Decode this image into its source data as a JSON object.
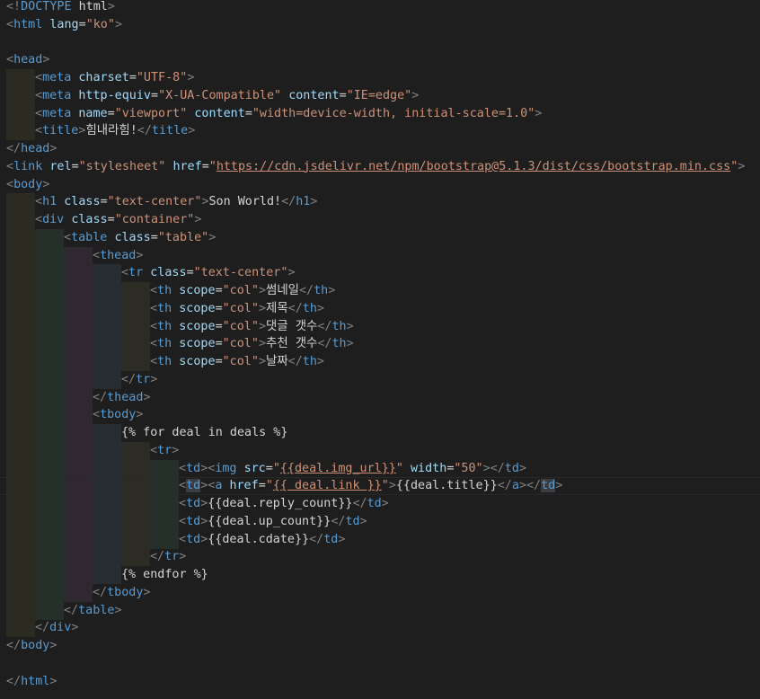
{
  "colors": {
    "background": "#1e1e1e",
    "bracket": "#808080",
    "tag": "#569cd6",
    "attribute": "#9cdcfe",
    "string": "#ce9178",
    "text": "#d4d4d4"
  },
  "lines": [
    {
      "indent": 0,
      "tokens": [
        [
          "bracket",
          "<!"
        ],
        [
          "tag",
          "DOCTYPE"
        ],
        [
          "text",
          " html"
        ],
        [
          "bracket",
          ">"
        ]
      ]
    },
    {
      "indent": 0,
      "tokens": [
        [
          "bracket",
          "<"
        ],
        [
          "tag",
          "html"
        ],
        [
          "text",
          " "
        ],
        [
          "attr",
          "lang"
        ],
        [
          "text",
          "="
        ],
        [
          "str",
          "\"ko\""
        ],
        [
          "bracket",
          ">"
        ]
      ]
    },
    {
      "indent": 0,
      "tokens": []
    },
    {
      "indent": 0,
      "tokens": [
        [
          "bracket",
          "<"
        ],
        [
          "tag",
          "head"
        ],
        [
          "bracket",
          ">"
        ]
      ]
    },
    {
      "indent": 1,
      "tokens": [
        [
          "bracket",
          "<"
        ],
        [
          "tag",
          "meta"
        ],
        [
          "text",
          " "
        ],
        [
          "attr",
          "charset"
        ],
        [
          "text",
          "="
        ],
        [
          "str",
          "\"UTF-8\""
        ],
        [
          "bracket",
          ">"
        ]
      ]
    },
    {
      "indent": 1,
      "tokens": [
        [
          "bracket",
          "<"
        ],
        [
          "tag",
          "meta"
        ],
        [
          "text",
          " "
        ],
        [
          "attr",
          "http-equiv"
        ],
        [
          "text",
          "="
        ],
        [
          "str",
          "\"X-UA-Compatible\""
        ],
        [
          "text",
          " "
        ],
        [
          "attr",
          "content"
        ],
        [
          "text",
          "="
        ],
        [
          "str",
          "\"IE=edge\""
        ],
        [
          "bracket",
          ">"
        ]
      ]
    },
    {
      "indent": 1,
      "tokens": [
        [
          "bracket",
          "<"
        ],
        [
          "tag",
          "meta"
        ],
        [
          "text",
          " "
        ],
        [
          "attr",
          "name"
        ],
        [
          "text",
          "="
        ],
        [
          "str",
          "\"viewport\""
        ],
        [
          "text",
          " "
        ],
        [
          "attr",
          "content"
        ],
        [
          "text",
          "="
        ],
        [
          "str",
          "\"width=device-width, initial-scale=1.0\""
        ],
        [
          "bracket",
          ">"
        ]
      ]
    },
    {
      "indent": 1,
      "tokens": [
        [
          "bracket",
          "<"
        ],
        [
          "tag",
          "title"
        ],
        [
          "bracket",
          ">"
        ],
        [
          "text",
          "힘내라힘!"
        ],
        [
          "bracket",
          "</"
        ],
        [
          "tag",
          "title"
        ],
        [
          "bracket",
          ">"
        ]
      ]
    },
    {
      "indent": 0,
      "tokens": [
        [
          "bracket",
          "</"
        ],
        [
          "tag",
          "head"
        ],
        [
          "bracket",
          ">"
        ]
      ]
    },
    {
      "indent": 0,
      "tokens": [
        [
          "bracket",
          "<"
        ],
        [
          "tag",
          "link"
        ],
        [
          "text",
          " "
        ],
        [
          "attr",
          "rel"
        ],
        [
          "text",
          "="
        ],
        [
          "str",
          "\"stylesheet\""
        ],
        [
          "text",
          " "
        ],
        [
          "attr",
          "href"
        ],
        [
          "text",
          "="
        ],
        [
          "str",
          "\""
        ],
        [
          "link",
          "https://cdn.jsdelivr.net/npm/bootstrap@5.1.3/dist/css/bootstrap.min.css"
        ],
        [
          "str",
          "\""
        ],
        [
          "bracket",
          ">"
        ]
      ]
    },
    {
      "indent": 0,
      "tokens": [
        [
          "bracket",
          "<"
        ],
        [
          "tag",
          "body"
        ],
        [
          "bracket",
          ">"
        ]
      ]
    },
    {
      "indent": 1,
      "tokens": [
        [
          "bracket",
          "<"
        ],
        [
          "tag",
          "h1"
        ],
        [
          "text",
          " "
        ],
        [
          "attr",
          "class"
        ],
        [
          "text",
          "="
        ],
        [
          "str",
          "\"text-center\""
        ],
        [
          "bracket",
          ">"
        ],
        [
          "text",
          "Son World!"
        ],
        [
          "bracket",
          "</"
        ],
        [
          "tag",
          "h1"
        ],
        [
          "bracket",
          ">"
        ]
      ]
    },
    {
      "indent": 1,
      "tokens": [
        [
          "bracket",
          "<"
        ],
        [
          "tag",
          "div"
        ],
        [
          "text",
          " "
        ],
        [
          "attr",
          "class"
        ],
        [
          "text",
          "="
        ],
        [
          "str",
          "\"container\""
        ],
        [
          "bracket",
          ">"
        ]
      ]
    },
    {
      "indent": 2,
      "tokens": [
        [
          "bracket",
          "<"
        ],
        [
          "tag",
          "table"
        ],
        [
          "text",
          " "
        ],
        [
          "attr",
          "class"
        ],
        [
          "text",
          "="
        ],
        [
          "str",
          "\"table\""
        ],
        [
          "bracket",
          ">"
        ]
      ]
    },
    {
      "indent": 3,
      "tokens": [
        [
          "bracket",
          "<"
        ],
        [
          "tag",
          "thead"
        ],
        [
          "bracket",
          ">"
        ]
      ]
    },
    {
      "indent": 4,
      "tokens": [
        [
          "bracket",
          "<"
        ],
        [
          "tag",
          "tr"
        ],
        [
          "text",
          " "
        ],
        [
          "attr",
          "class"
        ],
        [
          "text",
          "="
        ],
        [
          "str",
          "\"text-center\""
        ],
        [
          "bracket",
          ">"
        ]
      ]
    },
    {
      "indent": 5,
      "tokens": [
        [
          "bracket",
          "<"
        ],
        [
          "tag",
          "th"
        ],
        [
          "text",
          " "
        ],
        [
          "attr",
          "scope"
        ],
        [
          "text",
          "="
        ],
        [
          "str",
          "\"col\""
        ],
        [
          "bracket",
          ">"
        ],
        [
          "text",
          "썸네일"
        ],
        [
          "bracket",
          "</"
        ],
        [
          "tag",
          "th"
        ],
        [
          "bracket",
          ">"
        ]
      ]
    },
    {
      "indent": 5,
      "tokens": [
        [
          "bracket",
          "<"
        ],
        [
          "tag",
          "th"
        ],
        [
          "text",
          " "
        ],
        [
          "attr",
          "scope"
        ],
        [
          "text",
          "="
        ],
        [
          "str",
          "\"col\""
        ],
        [
          "bracket",
          ">"
        ],
        [
          "text",
          "제목"
        ],
        [
          "bracket",
          "</"
        ],
        [
          "tag",
          "th"
        ],
        [
          "bracket",
          ">"
        ]
      ]
    },
    {
      "indent": 5,
      "tokens": [
        [
          "bracket",
          "<"
        ],
        [
          "tag",
          "th"
        ],
        [
          "text",
          " "
        ],
        [
          "attr",
          "scope"
        ],
        [
          "text",
          "="
        ],
        [
          "str",
          "\"col\""
        ],
        [
          "bracket",
          ">"
        ],
        [
          "text",
          "댓글 갯수"
        ],
        [
          "bracket",
          "</"
        ],
        [
          "tag",
          "th"
        ],
        [
          "bracket",
          ">"
        ]
      ]
    },
    {
      "indent": 5,
      "tokens": [
        [
          "bracket",
          "<"
        ],
        [
          "tag",
          "th"
        ],
        [
          "text",
          " "
        ],
        [
          "attr",
          "scope"
        ],
        [
          "text",
          "="
        ],
        [
          "str",
          "\"col\""
        ],
        [
          "bracket",
          ">"
        ],
        [
          "text",
          "추천 갯수"
        ],
        [
          "bracket",
          "</"
        ],
        [
          "tag",
          "th"
        ],
        [
          "bracket",
          ">"
        ]
      ]
    },
    {
      "indent": 5,
      "tokens": [
        [
          "bracket",
          "<"
        ],
        [
          "tag",
          "th"
        ],
        [
          "text",
          " "
        ],
        [
          "attr",
          "scope"
        ],
        [
          "text",
          "="
        ],
        [
          "str",
          "\"col\""
        ],
        [
          "bracket",
          ">"
        ],
        [
          "text",
          "날짜"
        ],
        [
          "bracket",
          "</"
        ],
        [
          "tag",
          "th"
        ],
        [
          "bracket",
          ">"
        ]
      ]
    },
    {
      "indent": 4,
      "tokens": [
        [
          "bracket",
          "</"
        ],
        [
          "tag",
          "tr"
        ],
        [
          "bracket",
          ">"
        ]
      ]
    },
    {
      "indent": 3,
      "tokens": [
        [
          "bracket",
          "</"
        ],
        [
          "tag",
          "thead"
        ],
        [
          "bracket",
          ">"
        ]
      ]
    },
    {
      "indent": 3,
      "tokens": [
        [
          "bracket",
          "<"
        ],
        [
          "tag",
          "tbody"
        ],
        [
          "bracket",
          ">"
        ]
      ]
    },
    {
      "indent": 4,
      "tokens": [
        [
          "text",
          "{% for deal in deals %}"
        ]
      ]
    },
    {
      "indent": 5,
      "tokens": [
        [
          "bracket",
          "<"
        ],
        [
          "tag",
          "tr"
        ],
        [
          "bracket",
          ">"
        ]
      ]
    },
    {
      "indent": 6,
      "tokens": [
        [
          "bracket",
          "<"
        ],
        [
          "tag",
          "td"
        ],
        [
          "bracket",
          ">"
        ],
        [
          "bracket",
          "<"
        ],
        [
          "tag",
          "img"
        ],
        [
          "text",
          " "
        ],
        [
          "attr",
          "src"
        ],
        [
          "text",
          "="
        ],
        [
          "str",
          "\""
        ],
        [
          "link",
          "{{deal.img_url}}"
        ],
        [
          "str",
          "\""
        ],
        [
          "text",
          " "
        ],
        [
          "attr",
          "width"
        ],
        [
          "text",
          "="
        ],
        [
          "str",
          "\"50\""
        ],
        [
          "bracket",
          ">"
        ],
        [
          "bracket",
          "</"
        ],
        [
          "tag",
          "td"
        ],
        [
          "bracket",
          ">"
        ]
      ]
    },
    {
      "indent": 6,
      "current": true,
      "tokens": [
        [
          "bracket",
          "<"
        ],
        [
          "tagHl",
          "td"
        ],
        [
          "bracket",
          ">"
        ],
        [
          "bracket",
          "<"
        ],
        [
          "tag",
          "a"
        ],
        [
          "text",
          " "
        ],
        [
          "attr",
          "href"
        ],
        [
          "text",
          "="
        ],
        [
          "str",
          "\""
        ],
        [
          "link",
          "{{ deal.link }}"
        ],
        [
          "str",
          "\""
        ],
        [
          "bracket",
          ">"
        ],
        [
          "text",
          "{{deal.title}}"
        ],
        [
          "bracket",
          "</"
        ],
        [
          "tag",
          "a"
        ],
        [
          "bracket",
          ">"
        ],
        [
          "bracket",
          "</"
        ],
        [
          "tagHl",
          "td"
        ],
        [
          "bracket",
          ">"
        ]
      ]
    },
    {
      "indent": 6,
      "tokens": [
        [
          "bracket",
          "<"
        ],
        [
          "tag",
          "td"
        ],
        [
          "bracket",
          ">"
        ],
        [
          "text",
          "{{deal.reply_count}}"
        ],
        [
          "bracket",
          "</"
        ],
        [
          "tag",
          "td"
        ],
        [
          "bracket",
          ">"
        ]
      ]
    },
    {
      "indent": 6,
      "tokens": [
        [
          "bracket",
          "<"
        ],
        [
          "tag",
          "td"
        ],
        [
          "bracket",
          ">"
        ],
        [
          "text",
          "{{deal.up_count}}"
        ],
        [
          "bracket",
          "</"
        ],
        [
          "tag",
          "td"
        ],
        [
          "bracket",
          ">"
        ]
      ]
    },
    {
      "indent": 6,
      "tokens": [
        [
          "bracket",
          "<"
        ],
        [
          "tag",
          "td"
        ],
        [
          "bracket",
          ">"
        ],
        [
          "text",
          "{{deal.cdate}}"
        ],
        [
          "bracket",
          "</"
        ],
        [
          "tag",
          "td"
        ],
        [
          "bracket",
          ">"
        ]
      ]
    },
    {
      "indent": 5,
      "tokens": [
        [
          "bracket",
          "</"
        ],
        [
          "tag",
          "tr"
        ],
        [
          "bracket",
          ">"
        ]
      ]
    },
    {
      "indent": 4,
      "tokens": [
        [
          "text",
          "{% endfor %}"
        ]
      ]
    },
    {
      "indent": 3,
      "tokens": [
        [
          "bracket",
          "</"
        ],
        [
          "tag",
          "tbody"
        ],
        [
          "bracket",
          ">"
        ]
      ]
    },
    {
      "indent": 2,
      "tokens": [
        [
          "bracket",
          "</"
        ],
        [
          "tag",
          "table"
        ],
        [
          "bracket",
          ">"
        ]
      ]
    },
    {
      "indent": 1,
      "tokens": [
        [
          "bracket",
          "</"
        ],
        [
          "tag",
          "div"
        ],
        [
          "bracket",
          ">"
        ]
      ]
    },
    {
      "indent": 0,
      "tokens": [
        [
          "bracket",
          "</"
        ],
        [
          "tag",
          "body"
        ],
        [
          "bracket",
          ">"
        ]
      ]
    },
    {
      "indent": 0,
      "tokens": []
    },
    {
      "indent": 0,
      "tokens": [
        [
          "bracket",
          "</"
        ],
        [
          "tag",
          "html"
        ],
        [
          "bracket",
          ">"
        ]
      ]
    }
  ]
}
